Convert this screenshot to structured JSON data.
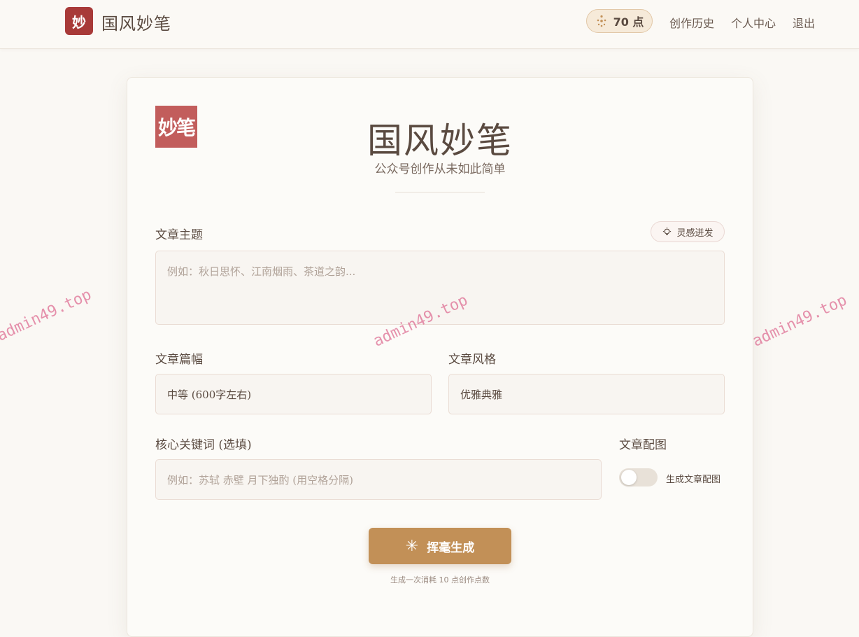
{
  "header": {
    "brand_badge": "妙",
    "brand_name": "国风妙笔",
    "points": "70 点",
    "nav": [
      "创作历史",
      "个人中心",
      "退出"
    ]
  },
  "card": {
    "stamp": "妙笔",
    "title": "国风妙笔",
    "subtitle": "公众号创作从未如此简单"
  },
  "form": {
    "topic_label": "文章主题",
    "inspire_button": "灵感迸发",
    "topic_placeholder": "例如：秋日思怀、江南烟雨、茶道之韵...",
    "length_label": "文章篇幅",
    "length_value": "中等 (600字左右)",
    "style_label": "文章风格",
    "style_value": "优雅典雅",
    "keywords_label": "核心关键词 (选填)",
    "keywords_placeholder": "例如：苏轼 赤壁 月下独酌 (用空格分隔)",
    "image_label": "文章配图",
    "image_toggle_label": "生成文章配图",
    "image_toggle_on": false,
    "submit": "挥毫生成",
    "cost_note": "生成一次消耗 10 点创作点数"
  },
  "watermark": "admin49.top",
  "colors": {
    "brand_red": "#a83a38",
    "stamp_red": "#c25d5c",
    "accent_gold": "#c29057"
  }
}
